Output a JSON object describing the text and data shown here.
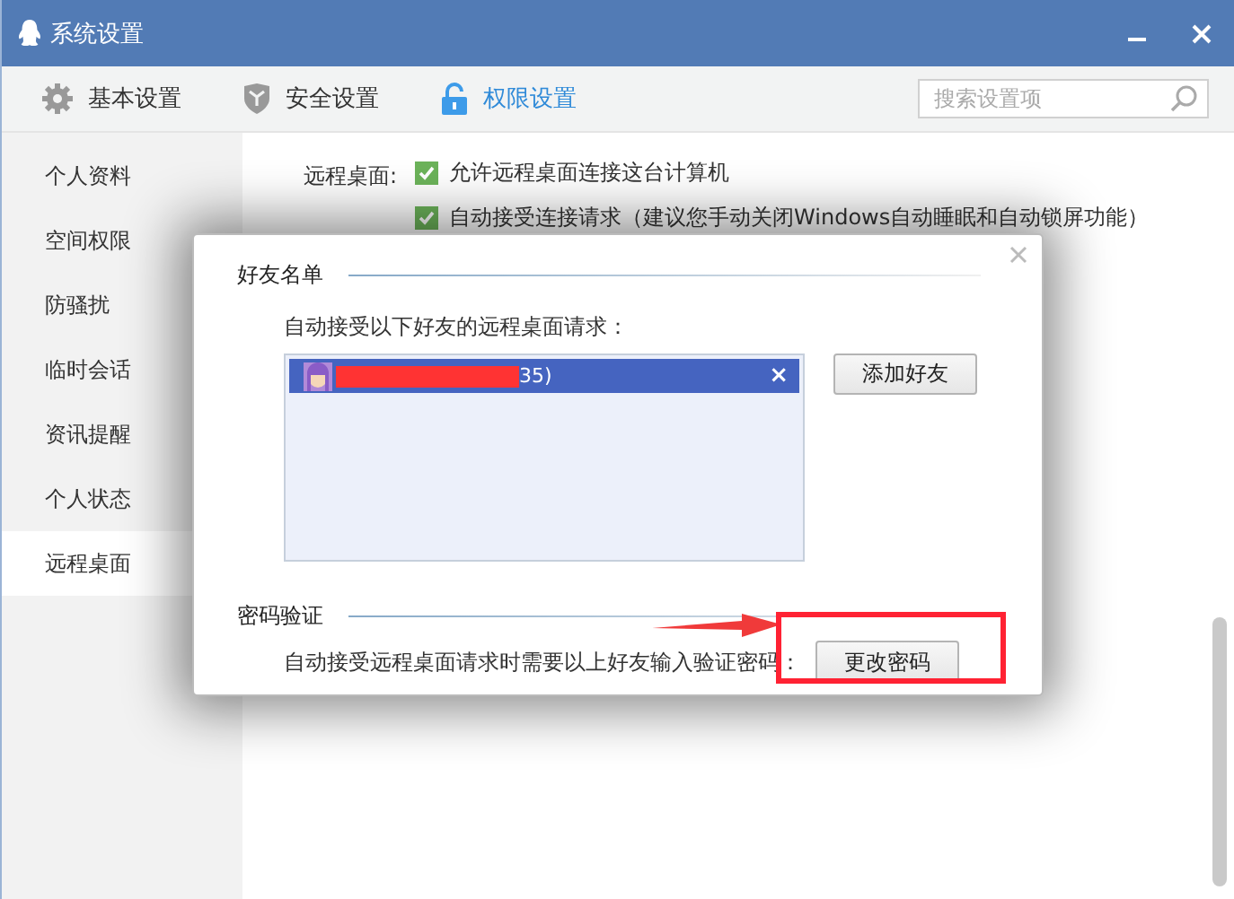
{
  "window": {
    "title": "系统设置"
  },
  "tabs": [
    {
      "label": "基本设置",
      "kind": "gear",
      "selected": false
    },
    {
      "label": "安全设置",
      "kind": "shield",
      "selected": false
    },
    {
      "label": "权限设置",
      "kind": "lock",
      "selected": true
    }
  ],
  "search": {
    "placeholder": "搜索设置项"
  },
  "sidebar": {
    "items": [
      {
        "label": "个人资料",
        "selected": false
      },
      {
        "label": "空间权限",
        "selected": false
      },
      {
        "label": "防骚扰",
        "selected": false
      },
      {
        "label": "临时会话",
        "selected": false
      },
      {
        "label": "资讯提醒",
        "selected": false
      },
      {
        "label": "个人状态",
        "selected": false
      },
      {
        "label": "远程桌面",
        "selected": true
      }
    ]
  },
  "remote_desktop": {
    "label": "远程桌面:",
    "options": [
      {
        "label": "允许远程桌面连接这台计算机",
        "checked": true
      },
      {
        "label": "自动接受连接请求（建议您手动关闭Windows自动睡眠和自动锁屏功能）",
        "checked": true
      }
    ]
  },
  "dialog": {
    "friends_section": {
      "title": "好友名单",
      "instruction": "自动接受以下好友的远程桌面请求：",
      "friends": [
        {
          "name": "35)",
          "redacted": true,
          "selected": true,
          "remove": "×"
        }
      ],
      "add_button": "添加好友"
    },
    "password_section": {
      "title": "密码验证",
      "instruction": "自动接受远程桌面请求时需要以上好友输入验证密码：",
      "button": "更改密码"
    }
  }
}
